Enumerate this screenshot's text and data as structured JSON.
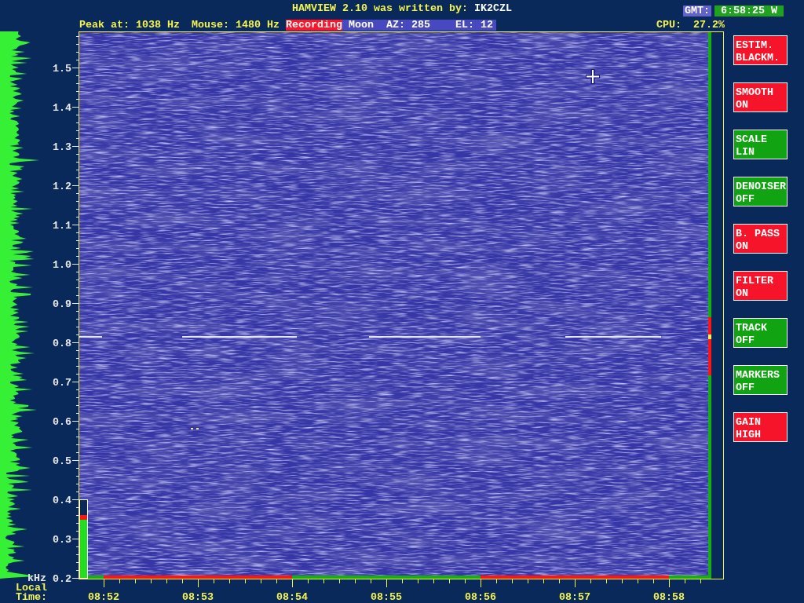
{
  "header": {
    "title": "HAMVIEW 2.10 was written by:",
    "author": "IK2CZL",
    "clock_label": "GMT:",
    "clock": "6:58:25 W"
  },
  "status": {
    "peak": "Peak at: 1038 Hz",
    "mouse": "Mouse: 1480 Hz",
    "recording": "Recording",
    "moon": {
      "label": "Moon",
      "azimuth_label": "AZ:",
      "azimuth": "285",
      "elevation_label": "EL:",
      "elevation": "12"
    },
    "cpu_label": "CPU:",
    "cpu": "27.2%"
  },
  "spectrogram": {
    "frequency_axis": {
      "unit": "kHz",
      "labels": [
        "1.5",
        "1.4",
        "1.3",
        "1.2",
        "1.1",
        "1.0",
        "0.9",
        "0.8",
        "0.7",
        "0.6",
        "0.5",
        "0.4",
        "0.3",
        "0.2"
      ]
    },
    "time_axis": {
      "title_lines": [
        "Local",
        "Time:"
      ],
      "labels": [
        "08:52",
        "08:53",
        "08:54",
        "08:55",
        "08:56",
        "08:57",
        "08:58"
      ]
    },
    "time_strip": [
      {
        "color": "#12b012"
      },
      {
        "color": "#ff1414"
      },
      {
        "color": "#ff1414"
      },
      {
        "color": "#12b012"
      },
      {
        "color": "#12b012"
      },
      {
        "color": "#ff1414"
      },
      {
        "color": "#ff1414"
      },
      {
        "color": "#12b012"
      }
    ],
    "input_meter": {
      "level": 0.81
    }
  },
  "buttons": [
    {
      "name": "ESTIM.",
      "value": "BLACKM.",
      "color": "#f5142a"
    },
    {
      "name": "SMOOTH",
      "value": "ON",
      "color": "#f5142a"
    },
    {
      "name": "SCALE",
      "value": "LIN",
      "color": "#12a312"
    },
    {
      "name": "DENOISER",
      "value": "OFF",
      "color": "#12a312"
    },
    {
      "name": "B. PASS",
      "value": "ON",
      "color": "#f5142a"
    },
    {
      "name": "FILTER",
      "value": "ON",
      "color": "#f5142a"
    },
    {
      "name": "TRACK",
      "value": "OFF",
      "color": "#12a312"
    },
    {
      "name": "MARKERS",
      "value": "OFF",
      "color": "#12a312"
    },
    {
      "name": "GAIN",
      "value": "HIGH",
      "color": "#f5142a"
    }
  ]
}
